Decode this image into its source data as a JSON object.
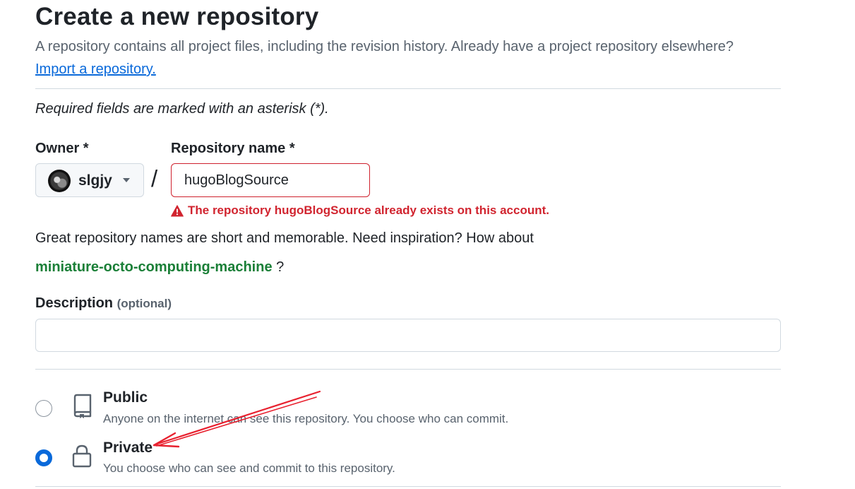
{
  "header": {
    "title": "Create a new repository",
    "subtitle": "A repository contains all project files, including the revision history. Already have a project repository elsewhere?",
    "import_link": "Import a repository."
  },
  "form": {
    "required_note": "Required fields are marked with an asterisk (*).",
    "owner": {
      "label": "Owner *",
      "value": "slgjy"
    },
    "separator": "/",
    "repo_name": {
      "label": "Repository name *",
      "value": "hugoBlogSource",
      "error": "The repository hugoBlogSource already exists on this account."
    },
    "inspiration": {
      "text": "Great repository names are short and memorable. Need inspiration? How about",
      "suggestion": "miniature-octo-computing-machine",
      "suffix": " ?"
    },
    "description": {
      "label": "Description",
      "optional": "(optional)",
      "value": ""
    },
    "visibility": {
      "options": [
        {
          "title": "Public",
          "description": "Anyone on the internet can see this repository. You choose who can commit.",
          "icon": "repo-icon",
          "selected": false
        },
        {
          "title": "Private",
          "description": "You choose who can see and commit to this repository.",
          "icon": "lock-icon",
          "selected": true
        }
      ]
    }
  },
  "colors": {
    "link": "#0969da",
    "error": "#d1242f",
    "suggestion": "#1a7f37",
    "radio_selected": "#0969da",
    "annotation_arrow": "#e8212f"
  }
}
